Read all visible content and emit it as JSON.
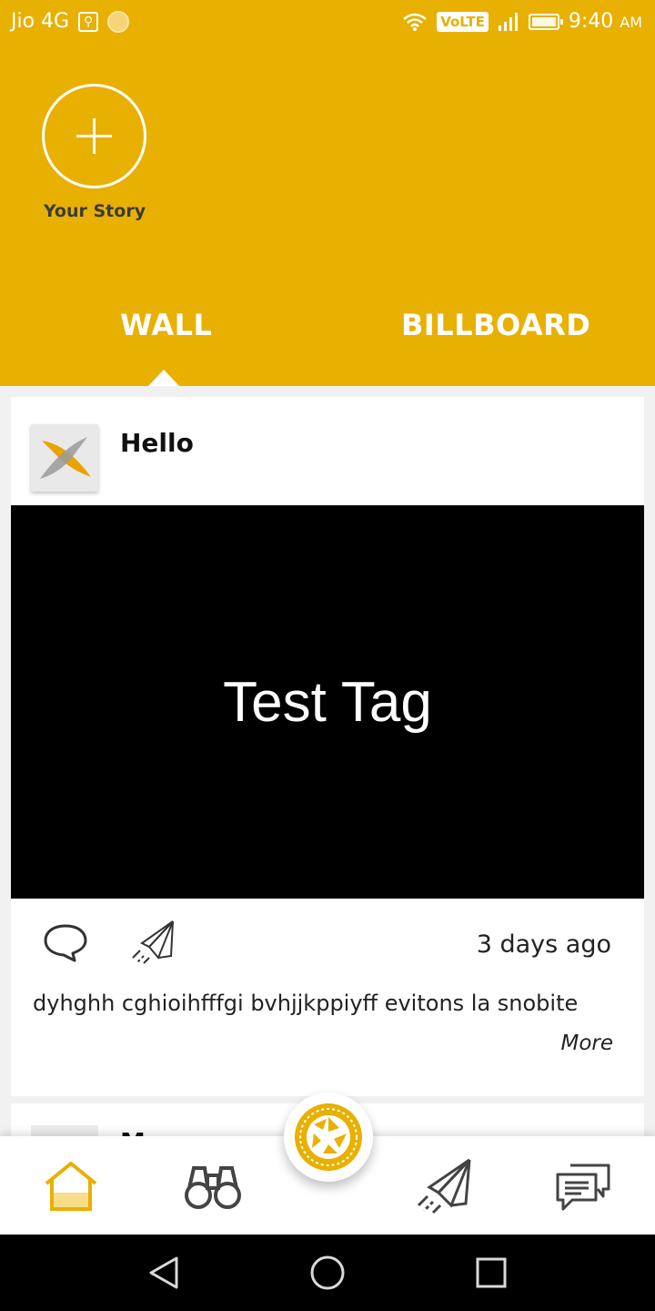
{
  "status_bar": {
    "carrier": "Jio 4G",
    "volte": "VoLTE",
    "time": "9:40",
    "ampm": "AM"
  },
  "story": {
    "label": "Your Story"
  },
  "tabs": [
    {
      "label": "WALL",
      "selected": true
    },
    {
      "label": "BILLBOARD",
      "selected": false
    }
  ],
  "post": {
    "title": "Hello",
    "media_text": "Test Tag",
    "timestamp": "3 days ago",
    "description": "dyhghh cghioihfffgi bvhjjkppiyff evitons la snobite",
    "more_label": "More"
  },
  "next_post": {
    "title": "M"
  },
  "colors": {
    "accent": "#e8b000",
    "nav_active": "#e8b000",
    "nav_inactive": "#444444"
  },
  "bottom_nav": {
    "items": [
      "home-icon",
      "binoculars-icon",
      "camera-aperture-icon",
      "paper-plane-icon",
      "chat-icon"
    ],
    "active": "home-icon"
  }
}
